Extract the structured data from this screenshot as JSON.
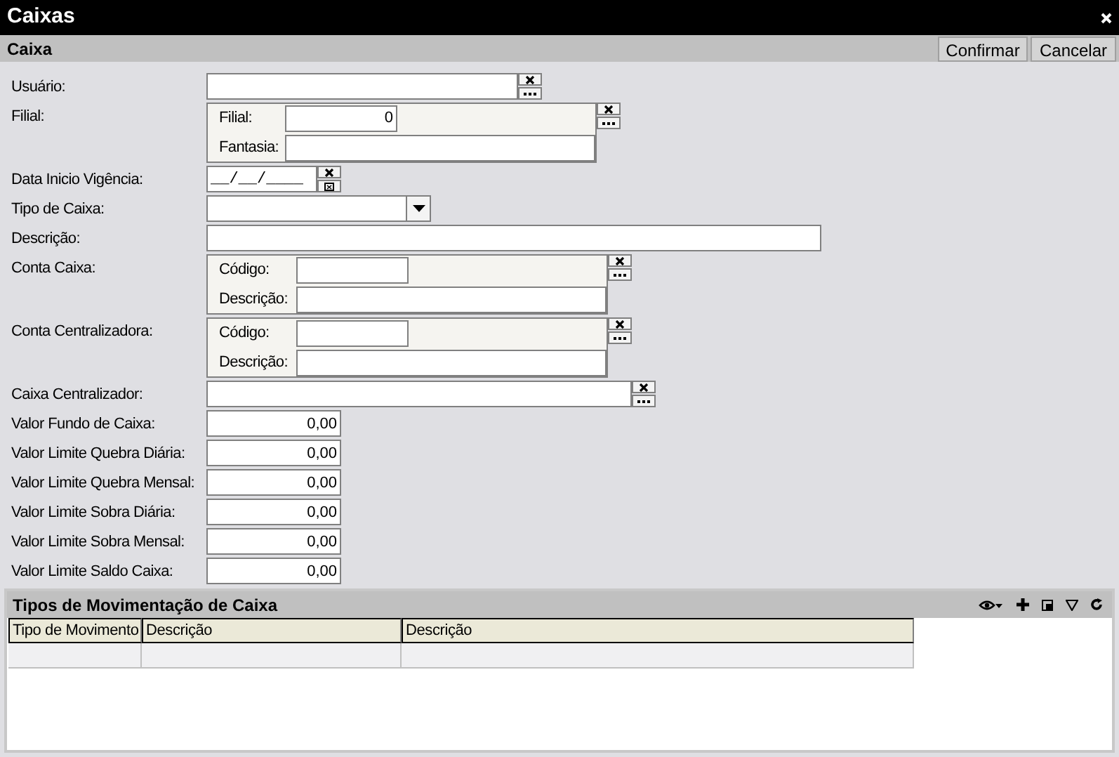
{
  "window": {
    "title": "Caixas"
  },
  "header": {
    "title": "Caixa",
    "buttons": [
      "Confirmar",
      "Cancelar"
    ]
  },
  "fields": [
    {
      "kind": "lookup",
      "label": "Usuário:"
    },
    {
      "kind": "group",
      "label": "Filial:",
      "subfields": [
        {
          "label": "Filial:",
          "value": "0"
        },
        {
          "label": "Fantasia:"
        }
      ]
    },
    {
      "kind": "date",
      "label": "Data Inicio Vigência:",
      "value": "__/__/____"
    },
    {
      "kind": "select",
      "label": "Tipo de Caixa:"
    },
    {
      "kind": "text",
      "label": "Descrição:"
    },
    {
      "kind": "group",
      "label": "Conta Caixa:",
      "subfields": [
        {
          "label": "Código:"
        },
        {
          "label": "Descrição:"
        }
      ]
    },
    {
      "kind": "group",
      "label": "Conta Centralizadora:",
      "subfields": [
        {
          "label": "Código:"
        },
        {
          "label": "Descrição:"
        }
      ]
    },
    {
      "kind": "lookup",
      "label": "Caixa Centralizador:"
    },
    {
      "kind": "number",
      "label": "Valor Fundo de Caixa:",
      "value": "0,00"
    },
    {
      "kind": "number",
      "label": "Valor Limite Quebra Diária:",
      "value": "0,00"
    },
    {
      "kind": "number",
      "label": "Valor Limite Quebra Mensal:",
      "value": "0,00"
    },
    {
      "kind": "number",
      "label": "Valor Limite Sobra Diária:",
      "value": "0,00"
    },
    {
      "kind": "number",
      "label": "Valor Limite Sobra Mensal:",
      "value": "0,00"
    },
    {
      "kind": "number",
      "label": "Valor Limite Saldo Caixa:",
      "value": "0,00"
    }
  ],
  "grid": {
    "title": "Tipos de Movimentação de Caixa",
    "columns": [
      "Tipo de Movimento",
      "Descrição",
      "Descrição"
    ]
  }
}
